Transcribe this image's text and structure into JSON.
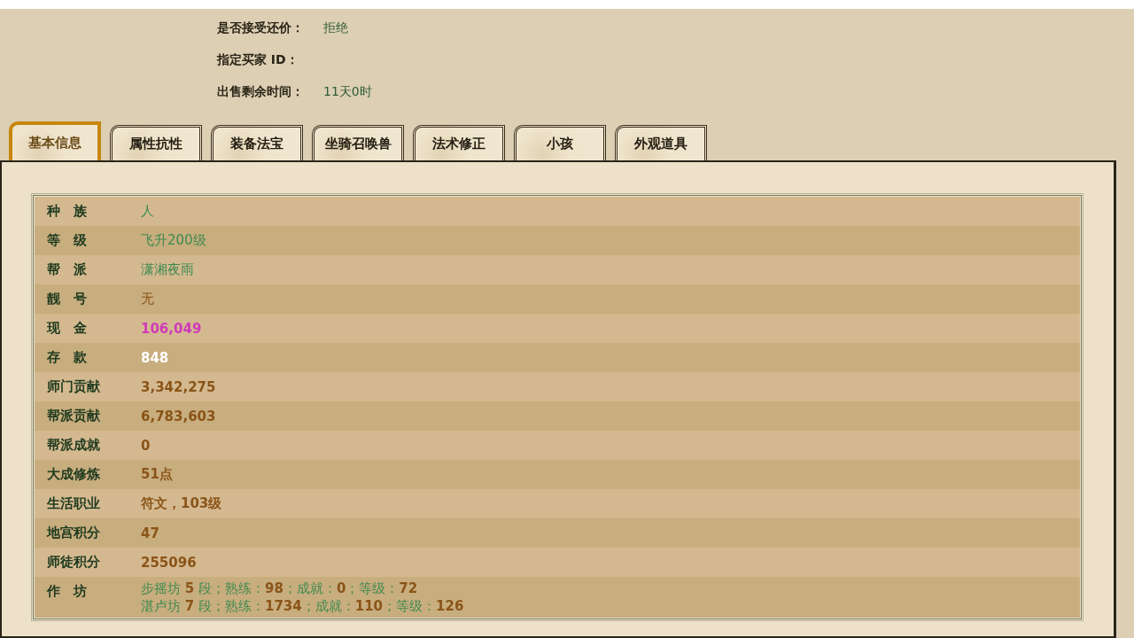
{
  "sale_info": [
    {
      "label": "是否接受还价：",
      "value": "拒绝"
    },
    {
      "label": "指定买家 ID："
    },
    {
      "label": "出售剩余时间：",
      "value": "11天0时"
    }
  ],
  "tabs": [
    {
      "label": "基本信息",
      "selected": true
    },
    {
      "label": "属性抗性",
      "selected": false
    },
    {
      "label": "装备法宝",
      "selected": false
    },
    {
      "label": "坐骑召唤兽",
      "selected": false
    },
    {
      "label": "法术修正",
      "selected": false
    },
    {
      "label": "小孩",
      "selected": false
    },
    {
      "label": "外观道具",
      "selected": false
    }
  ],
  "basic_info": [
    {
      "label": "种　族",
      "value": "人",
      "kind": "plain",
      "color": "#3f8a50"
    },
    {
      "label": "等　级",
      "value": "飞升200级",
      "kind": "plain",
      "color": "#3f8a50"
    },
    {
      "label": "帮　派",
      "value": "潇湘夜雨",
      "kind": "plain",
      "color": "#3f8a50"
    },
    {
      "label": "靓　号",
      "value": "无",
      "kind": "plain",
      "color": "#8a5418"
    },
    {
      "label": "现　金",
      "value": "106,049",
      "kind": "bold",
      "color": "#d03ab8"
    },
    {
      "label": "存　款",
      "value": "848",
      "kind": "bold",
      "color": "#ffffff"
    },
    {
      "label": "师门贡献",
      "value": "3,342,275",
      "kind": "bold",
      "color": "#8a5418"
    },
    {
      "label": "帮派贡献",
      "value": "6,783,603",
      "kind": "bold",
      "color": "#8a5418"
    },
    {
      "label": "帮派成就",
      "value": "0",
      "kind": "bold",
      "color": "#8a5418"
    },
    {
      "label": "大成修炼",
      "value": "51点",
      "kind": "bold",
      "color": "#8a5418"
    },
    {
      "label": "生活职业",
      "value": "符文，103级",
      "kind": "bold",
      "color": "#8a5418"
    },
    {
      "label": "地宫积分",
      "value": "47",
      "kind": "bold",
      "color": "#8a5418"
    },
    {
      "label": "师徒积分",
      "value": "255096",
      "kind": "bold",
      "color": "#8a5418"
    },
    {
      "label": "作　坊",
      "kind": "lines",
      "color": "#3f8a50",
      "lines": [
        "步摇坊 **5** 段；熟练：**98**；成就：**0**；等级：**72**",
        "湛卢坊 **7** 段；熟练：**1734**；成就：**110**；等级：**126**"
      ]
    }
  ]
}
